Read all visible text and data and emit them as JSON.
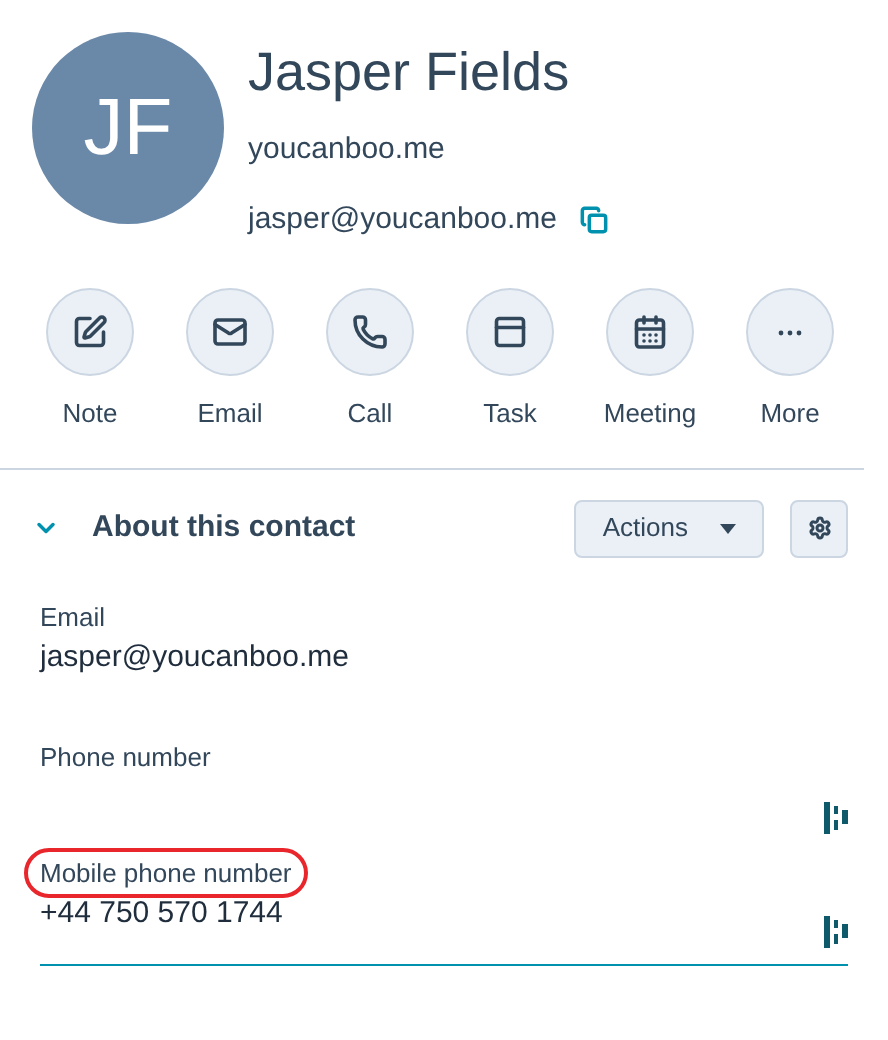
{
  "contact": {
    "initials": "JF",
    "name": "Jasper Fields",
    "company": "youcanboo.me",
    "email": "jasper@youcanboo.me"
  },
  "actions": [
    {
      "kind": "note",
      "label": "Note"
    },
    {
      "kind": "email",
      "label": "Email"
    },
    {
      "kind": "call",
      "label": "Call"
    },
    {
      "kind": "task",
      "label": "Task"
    },
    {
      "kind": "meeting",
      "label": "Meeting"
    },
    {
      "kind": "more",
      "label": "More"
    }
  ],
  "section": {
    "title": "About this contact",
    "expanded": true,
    "actions_button": "Actions"
  },
  "properties": [
    {
      "kind": "text",
      "label": "Email",
      "value": "jasper@youcanboo.me",
      "highlighted": false,
      "focused": false
    },
    {
      "kind": "phone",
      "label": "Phone number",
      "highlighted": false,
      "focused": false
    },
    {
      "kind": "phone",
      "label": "Mobile phone number",
      "value": "+44 750 570 1744",
      "highlighted": true,
      "focused": true
    }
  ]
}
